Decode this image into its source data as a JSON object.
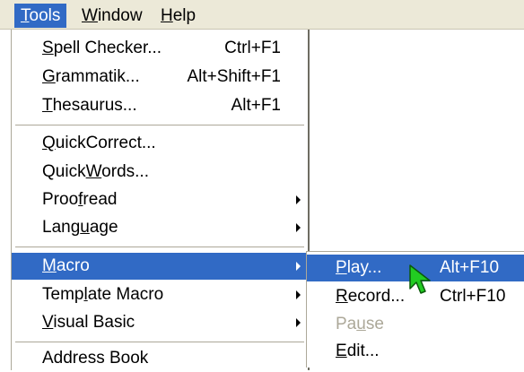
{
  "menubar": {
    "items": [
      {
        "pre": "",
        "ul": "T",
        "post": "ools"
      },
      {
        "pre": "",
        "ul": "W",
        "post": "indow"
      },
      {
        "pre": "",
        "ul": "H",
        "post": "elp"
      }
    ]
  },
  "tools_menu": {
    "items": [
      {
        "pre": "",
        "ul": "S",
        "post": "pell Checker...",
        "shortcut": "Ctrl+F1"
      },
      {
        "pre": "",
        "ul": "G",
        "post": "rammatik...",
        "shortcut": "Alt+Shift+F1"
      },
      {
        "pre": "",
        "ul": "T",
        "post": "hesaurus...",
        "shortcut": "Alt+F1"
      },
      {
        "pre": "",
        "ul": "Q",
        "post": "uickCorrect..."
      },
      {
        "pre": "Quick",
        "ul": "W",
        "post": "ords..."
      },
      {
        "pre": "Proo",
        "ul": "f",
        "post": "read"
      },
      {
        "pre": "Lang",
        "ul": "u",
        "post": "age"
      },
      {
        "pre": "",
        "ul": "M",
        "post": "acro"
      },
      {
        "pre": "Temp",
        "ul": "l",
        "post": "ate Macro"
      },
      {
        "pre": "",
        "ul": "V",
        "post": "isual Basic"
      },
      {
        "pre": "",
        "ul": "",
        "post": "Address Book"
      }
    ]
  },
  "macro_submenu": {
    "items": [
      {
        "pre": "",
        "ul": "P",
        "post": "lay...",
        "shortcut": "Alt+F10"
      },
      {
        "pre": "",
        "ul": "R",
        "post": "ecord...",
        "shortcut": "Ctrl+F10"
      },
      {
        "pre": "Pa",
        "ul": "u",
        "post": "se"
      },
      {
        "pre": "",
        "ul": "E",
        "post": "dit..."
      }
    ]
  },
  "colors": {
    "highlight": "#316ac5",
    "menubar_bg": "#ece9d8",
    "disabled_text": "#aca899",
    "cursor_fill": "#22cc22"
  },
  "icons": [
    "submenu-arrow-icon",
    "mouse-pointer-icon"
  ]
}
